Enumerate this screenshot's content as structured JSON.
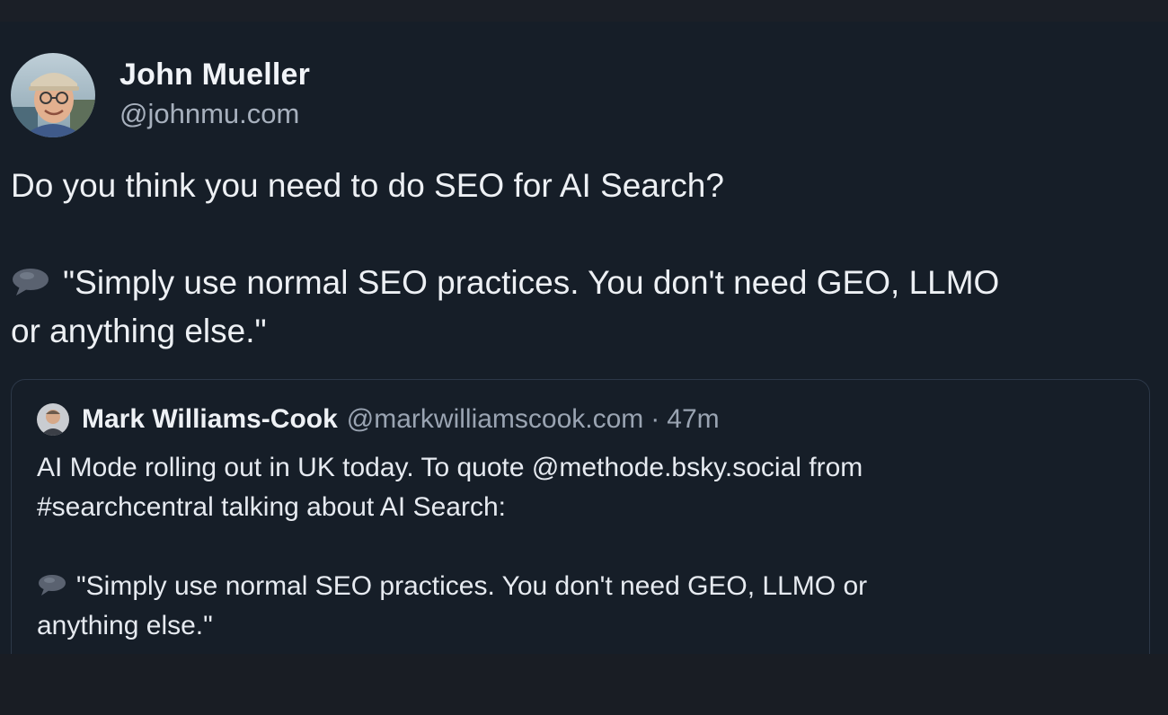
{
  "post": {
    "author": {
      "display_name": "John Mueller",
      "handle": "@johnmu.com",
      "avatar_icon": "profile-photo"
    },
    "text_line_1": "Do you think you need to do SEO for AI Search?",
    "quote_icon": "speech-bubble-icon",
    "text_quote_line_1": "\"Simply use normal SEO practices. You don't need GEO, LLMO",
    "text_quote_line_2": "or anything else.\""
  },
  "quoted_post": {
    "author": {
      "display_name": "Mark Williams-Cook",
      "handle": "@markwilliamscook.com",
      "separator": "·",
      "time": "47m"
    },
    "text_line_1": "AI Mode rolling out in UK today. To quote @methode.bsky.social from",
    "text_line_2": "#searchcentral talking about AI Search:",
    "quote_icon": "speech-bubble-icon",
    "text_quote_line_1": "\"Simply use normal SEO practices. You don't need GEO, LLMO or",
    "text_quote_line_2": "anything else.\""
  },
  "colors": {
    "background": "#161e28",
    "text_primary": "#edf0f4",
    "text_secondary": "#a7b0bd",
    "card_border": "#2c3848"
  }
}
